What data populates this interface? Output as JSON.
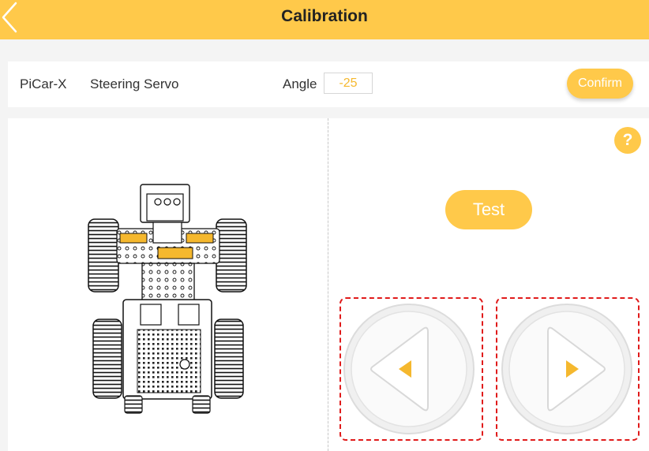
{
  "header": {
    "title": "Calibration",
    "back_icon": "chevron-left-icon",
    "color": "#ffc94a"
  },
  "toolbar": {
    "model": "PiCar-X",
    "servo": "Steering Servo",
    "angle_label": "Angle",
    "angle_value": "-25",
    "confirm_label": "Confirm"
  },
  "controls": {
    "help_label": "?",
    "test_label": "Test",
    "left_icon": "triangle-left-icon",
    "right_icon": "triangle-right-icon"
  },
  "colors": {
    "accent": "#ffc94a",
    "highlight_border": "#e01b1b",
    "angle_text": "#f5b82e"
  }
}
